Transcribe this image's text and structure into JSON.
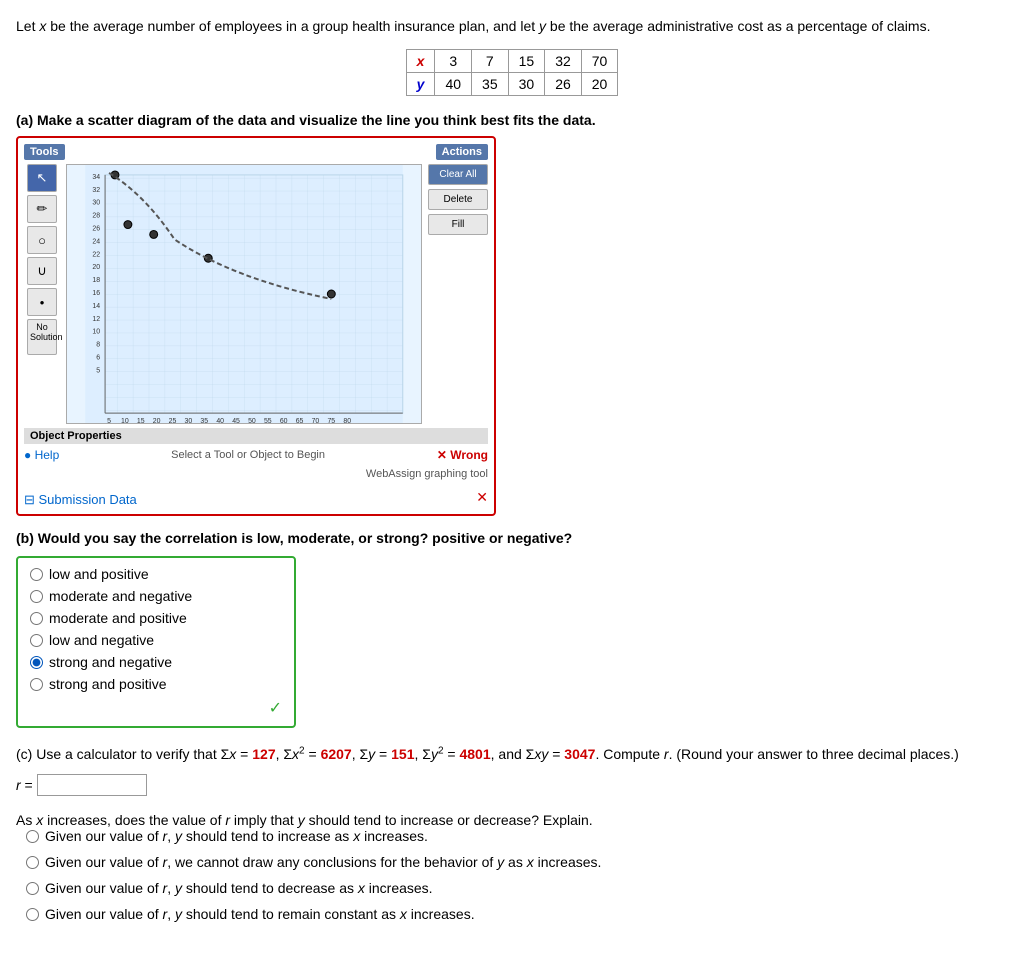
{
  "intro": {
    "text": "Let x be the average number of employees in a group health insurance plan, and let y be the average administrative cost as a percentage of claims."
  },
  "table": {
    "x_label": "x",
    "y_label": "y",
    "x_values": [
      "3",
      "7",
      "15",
      "32",
      "70"
    ],
    "y_values": [
      "40",
      "35",
      "30",
      "26",
      "20"
    ]
  },
  "part_a": {
    "label": "(a) Make a scatter diagram of the data and visualize the line you think best fits the data.",
    "tools_label": "Tools",
    "actions_label": "Actions",
    "clear_all": "Clear All",
    "delete": "Delete",
    "fill": "Fill",
    "no_solution": "No Solution",
    "object_properties": "Object Properties",
    "select_prompt": "Select a Tool or Object to Begin",
    "help_label": "Help",
    "wrong_label": "Wrong",
    "webassign_label": "WebAssign graphing tool",
    "submission_data": "⊟ Submission Data"
  },
  "part_b": {
    "label": "(b) Would you say the correlation is low, moderate, or strong? positive or negative?",
    "options": [
      {
        "id": "opt1",
        "label": "low and positive",
        "selected": false
      },
      {
        "id": "opt2",
        "label": "moderate and negative",
        "selected": false
      },
      {
        "id": "opt3",
        "label": "moderate and positive",
        "selected": false
      },
      {
        "id": "opt4",
        "label": "low and negative",
        "selected": false
      },
      {
        "id": "opt5",
        "label": "strong and negative",
        "selected": true
      },
      {
        "id": "opt6",
        "label": "strong and positive",
        "selected": false
      }
    ]
  },
  "part_c": {
    "label": "(c) Use a calculator to verify that Σx = 127, Σx² = 6207, Σy = 151, Σy² = 4801, and Σxy = 3047. Compute r. (Round your answer to three decimal places.)",
    "r_label": "r =",
    "sigma_x": "127",
    "sigma_x2": "6207",
    "sigma_y": "151",
    "sigma_y2": "4801",
    "sigma_xy": "3047"
  },
  "part_d": {
    "label": "As x increases, does the value of r imply that y should tend to increase or decrease? Explain.",
    "options": [
      {
        "id": "d1",
        "label": "Given our value of r, y should tend to increase as x increases."
      },
      {
        "id": "d2",
        "label": "Given our value of r, we cannot draw any conclusions for the behavior of y as x increases."
      },
      {
        "id": "d3",
        "label": "Given our value of r, y should tend to decrease as x increases."
      },
      {
        "id": "d4",
        "label": "Given our value of r, y should tend to remain constant as x increases."
      }
    ]
  }
}
